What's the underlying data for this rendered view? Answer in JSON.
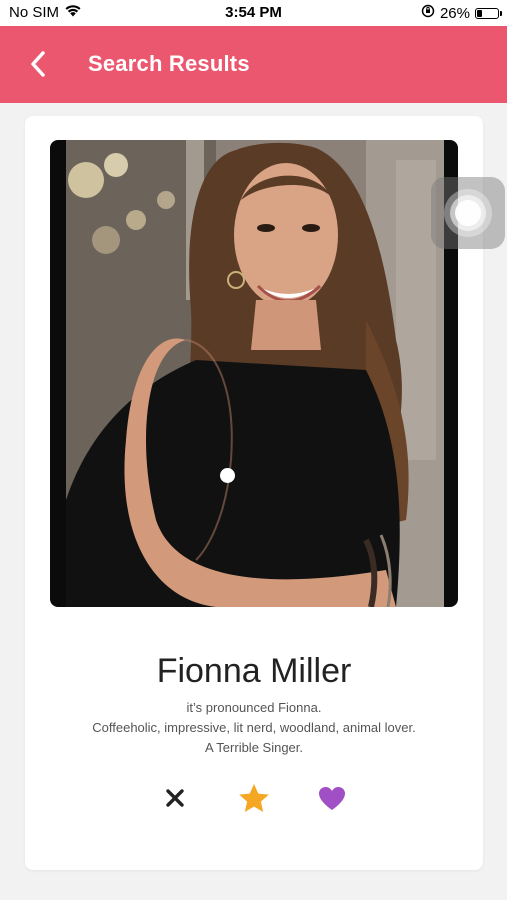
{
  "status_bar": {
    "carrier": "No SIM",
    "time": "3:54 PM",
    "battery_percent": "26%",
    "battery_level": 0.26
  },
  "header": {
    "title": "Search Results",
    "back_icon": "chevron-left-icon",
    "background_color": "#ec5770"
  },
  "profile": {
    "name": "Fionna Miller",
    "bio_lines": [
      "it’s pronounced Fionna.",
      "Coffeeholic, impressive, lit nerd, woodland, animal lover.",
      "A Terrible Singer."
    ],
    "photo_count": 1,
    "current_photo": 1
  },
  "actions": {
    "dislike": {
      "icon": "close-icon",
      "color": "#222222"
    },
    "super_like": {
      "icon": "star-icon",
      "color": "#f5a623"
    },
    "like": {
      "icon": "heart-icon",
      "color": "#a04fc4"
    }
  }
}
